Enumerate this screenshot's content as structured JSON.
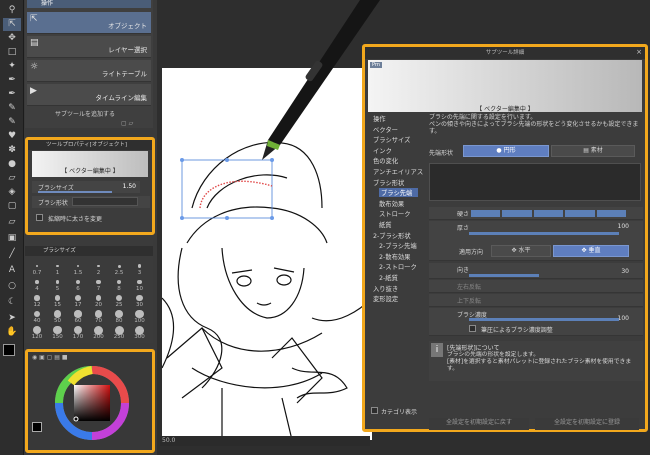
{
  "subtool": {
    "header": "操作",
    "items": [
      "オブジェクト",
      "レイヤー選択",
      "ライトテーブル",
      "タイムライン編集"
    ],
    "add_label": "サブツールを追加する"
  },
  "toolprop": {
    "title": "ツールプロパティ[オブジェクト]",
    "banner": "【 ベクター編集中 】",
    "brush_size_label": "ブラシサイズ",
    "brush_size_value": "1.50",
    "brush_shape_label": "ブラシ形状",
    "keep_thickness_label": "拡縮時に太さを変更"
  },
  "brushsize": {
    "title": "ブラシサイズ",
    "sizes": [
      "0.7",
      "1",
      "1.5",
      "2",
      "2.5",
      "3",
      "4",
      "5",
      "6",
      "7",
      "8",
      "10",
      "12",
      "15",
      "17",
      "20",
      "25",
      "30",
      "40",
      "50",
      "60",
      "70",
      "80",
      "100",
      "120",
      "150",
      "170",
      "200",
      "250",
      "300"
    ]
  },
  "dialog": {
    "title": "サブツール詳細",
    "tag": "Prn",
    "banner": "【 ベクター編集中 】",
    "categories": [
      "操作",
      "ベクター",
      "ブラシサイズ",
      "インク",
      "色の変化",
      "アンチエイリアス",
      "ブラシ形状",
      "ブラシ先端",
      "散布効果",
      "ストローク",
      "紙質",
      "2-ブラシ形状",
      "2-ブラシ先端",
      "2-散布効果",
      "2-ストローク",
      "2-紙質",
      "入り抜き",
      "変形設定"
    ],
    "active_category": "ブラシ先端",
    "description": "ブラシの先端に関する設定を行います。\nペンの傾きや向きによってブラシ先端の形状をどう変化させるかも設定できます。",
    "tip_shape_label": "先端形状",
    "tip_round": "円形",
    "tip_material": "素材",
    "hardness_label": "硬さ",
    "thickness_label": "厚さ",
    "apply_direction_label": "適用方向",
    "horizontal": "水平",
    "vertical": "垂直",
    "thickness_value": "100",
    "direction_label": "向き",
    "direction_value": "30",
    "flip_h": "左右反転",
    "flip_v": "上下反転",
    "brush_density_label": "ブラシ濃度",
    "brush_density_value": "100",
    "pressure_density_label": "筆圧によるブラシ濃度調整",
    "info_title": "[先端形状]について",
    "info_text": "ブラシの先端の形状を設定します。\n[素材]を選択すると素材パレットに登録されたブラシ素材を使用できます。",
    "category_display": "カテゴリ表示",
    "reset_all": "全設定を初期設定に戻す",
    "register_all": "全設定を初期設定に登録"
  },
  "canvas": {
    "zoom": "50.0"
  },
  "colors": {
    "highlight": "#f2a81d",
    "active_blue": "#4e6ba6"
  }
}
